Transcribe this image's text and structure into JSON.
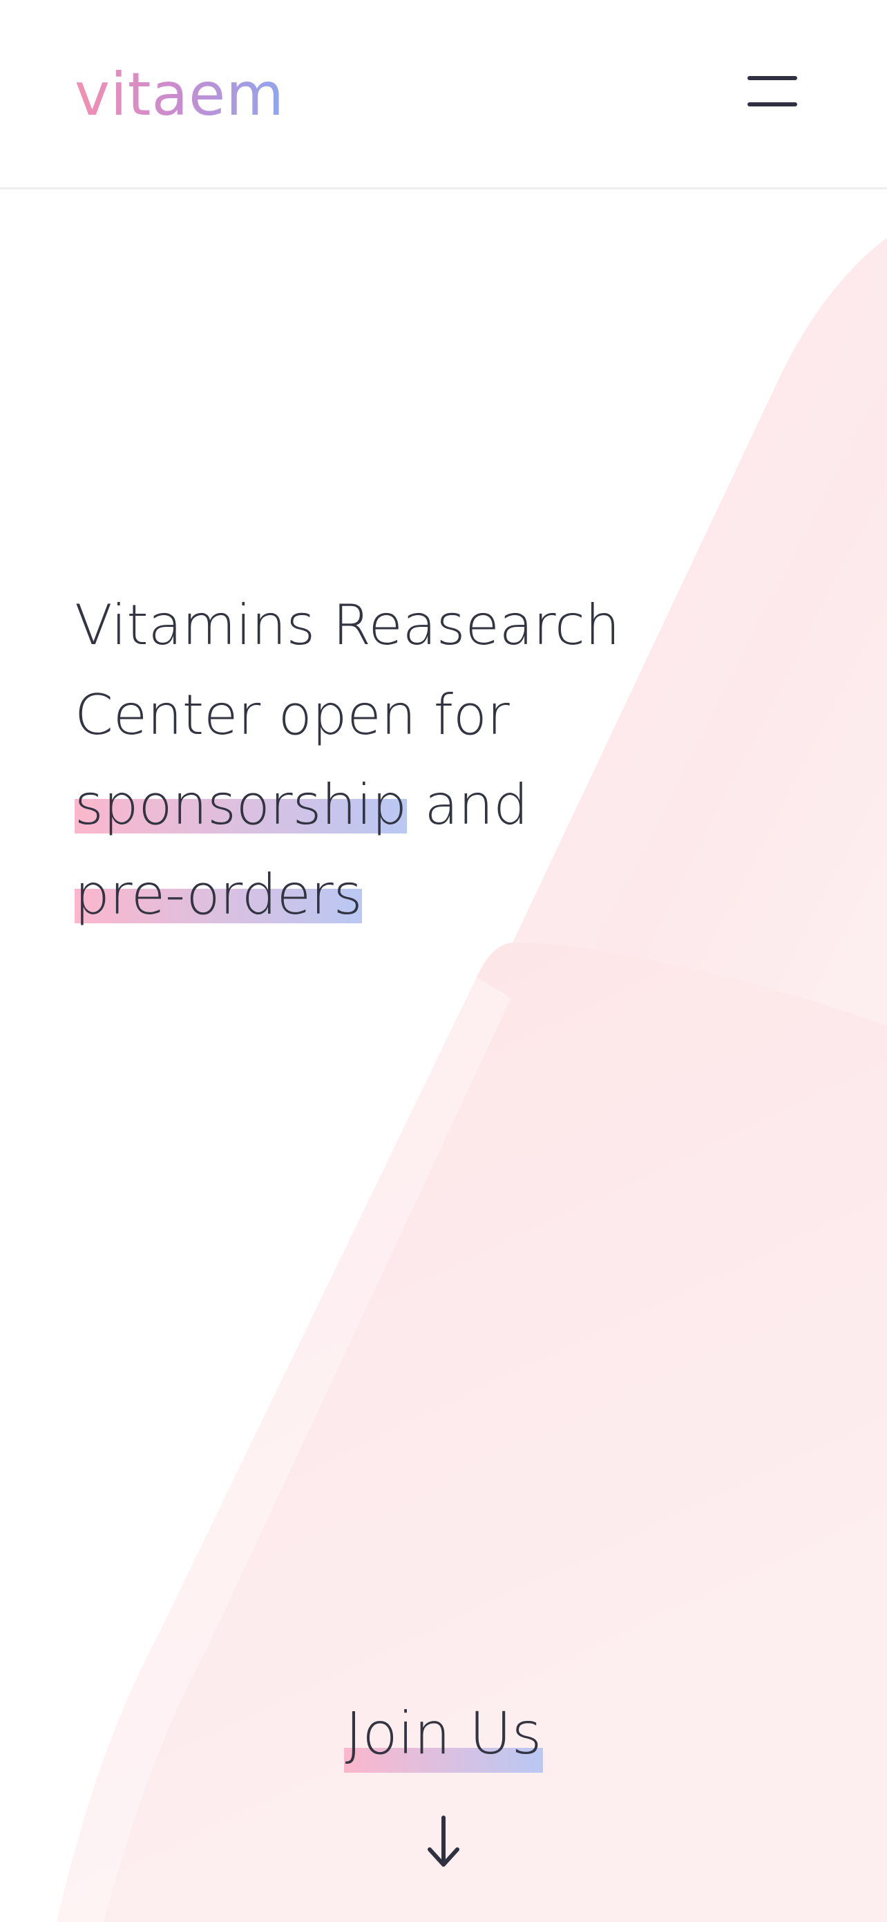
{
  "header": {
    "logo_text": "vitaem",
    "menu_icon": "hamburger-menu-icon"
  },
  "hero": {
    "line1": "Vitamins Reasearch",
    "line2": "Center open for",
    "highlight1": "sponsorship",
    "connector": " and",
    "highlight2": "pre-orders"
  },
  "cta": {
    "label": "Join Us",
    "arrow_icon": "arrow-down-icon"
  },
  "colors": {
    "logo_gradient_start": "#f48fb1",
    "logo_gradient_end": "#8fa6ee",
    "text": "#323442",
    "highlight_pink": "#fbb7cc",
    "highlight_blue": "#b9c8f3",
    "background_shape": "#fde8ea"
  }
}
